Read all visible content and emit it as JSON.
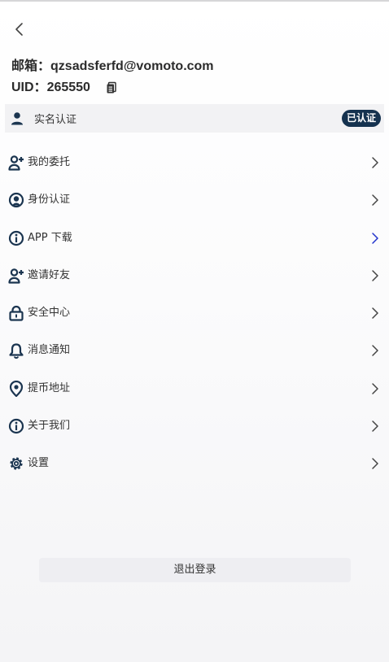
{
  "account": {
    "email_label": "邮箱：",
    "email": "qzsadsferfd@vomoto.com",
    "uid_label": "UID：",
    "uid": "265550"
  },
  "verification": {
    "label": "实名认证",
    "badge": "已认证"
  },
  "menu": [
    {
      "label": "我的委托",
      "icon": "user-plus-icon"
    },
    {
      "label": "身份认证",
      "icon": "id-badge-icon"
    },
    {
      "label": "APP 下载",
      "icon": "info-circle-icon",
      "chevron_color": "#2233cc"
    },
    {
      "label": "邀请好友",
      "icon": "user-plus-icon"
    },
    {
      "label": "安全中心",
      "icon": "lock-icon"
    },
    {
      "label": "消息通知",
      "icon": "bell-icon"
    },
    {
      "label": "提币地址",
      "icon": "location-pin-icon"
    },
    {
      "label": "关于我们",
      "icon": "info-circle-icon"
    },
    {
      "label": "设置",
      "icon": "gear-icon"
    }
  ],
  "logout": {
    "label": "退出登录"
  },
  "colors": {
    "icon": "#1b3550",
    "badge_bg": "#15324f",
    "chevron": "#444444"
  }
}
